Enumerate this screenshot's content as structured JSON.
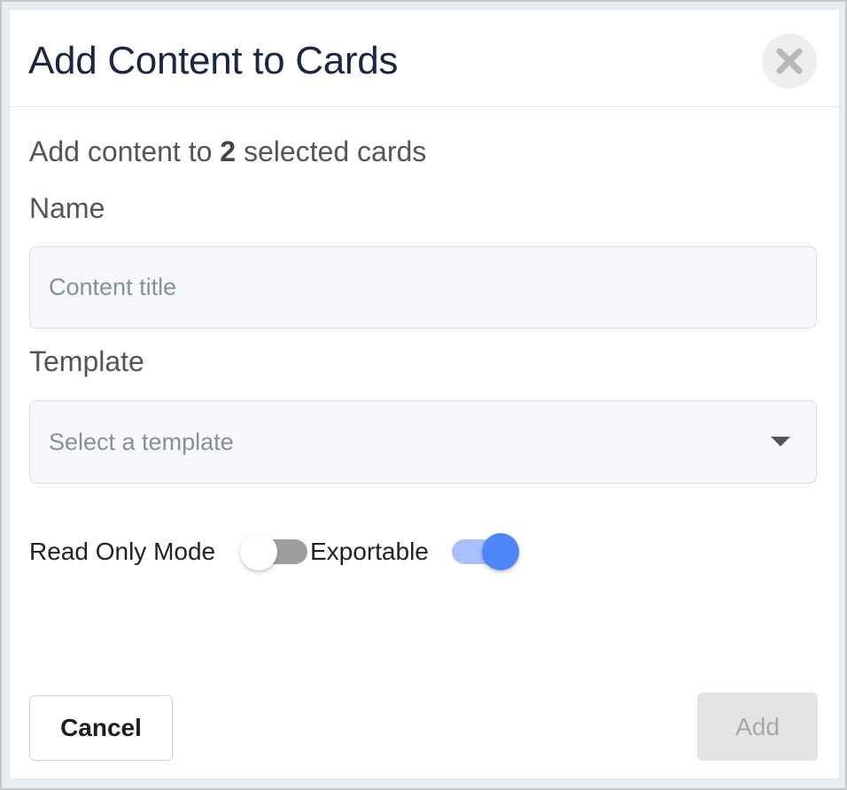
{
  "dialog": {
    "title": "Add Content to Cards",
    "subtitle_prefix": "Add content to ",
    "selected_count": "2",
    "subtitle_suffix": " selected cards",
    "close_icon": "close-icon"
  },
  "form": {
    "name_label": "Name",
    "name_value": "",
    "name_placeholder": "Content title",
    "template_label": "Template",
    "template_placeholder": "Select a template",
    "read_only_label": "Read Only Mode",
    "read_only_enabled": false,
    "exportable_label": "Exportable",
    "exportable_enabled": true
  },
  "footer": {
    "cancel_label": "Cancel",
    "add_label": "Add",
    "add_disabled": true
  },
  "colors": {
    "title": "#1c2541",
    "toggle_on": "#4f86f7",
    "toggle_on_track": "#a8c1fb",
    "toggle_off_track": "#9e9e9e"
  }
}
